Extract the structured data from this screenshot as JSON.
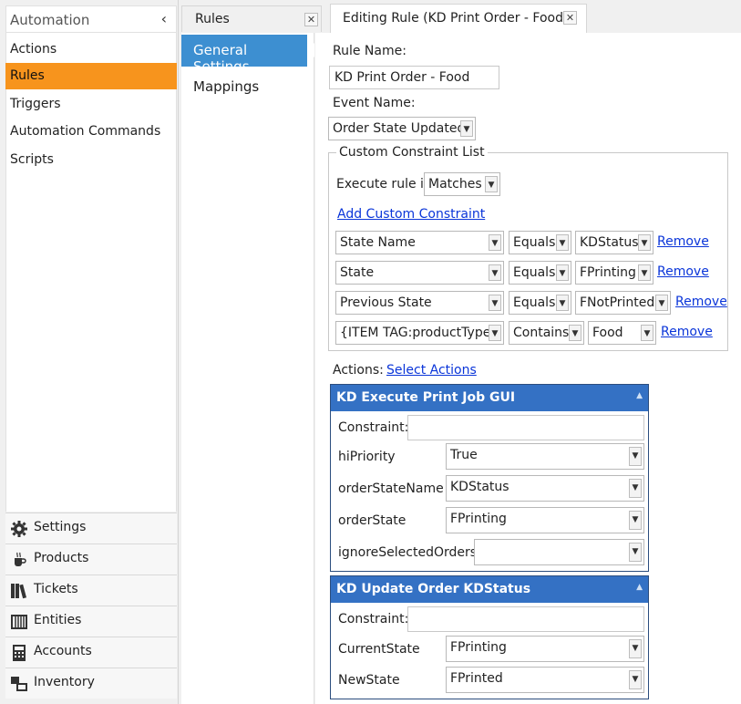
{
  "sidebar": {
    "header": "Automation",
    "items": [
      {
        "label": "Actions",
        "active": false
      },
      {
        "label": "Rules",
        "active": true
      },
      {
        "label": "Triggers",
        "active": false
      },
      {
        "label": "Automation Commands",
        "active": false
      },
      {
        "label": "Scripts",
        "active": false
      }
    ],
    "bottom_nav": [
      {
        "label": "Settings",
        "icon": "gear-icon"
      },
      {
        "label": "Products",
        "icon": "coffee-cup-icon"
      },
      {
        "label": "Tickets",
        "icon": "books-icon"
      },
      {
        "label": "Entities",
        "icon": "table-grid-icon"
      },
      {
        "label": "Accounts",
        "icon": "calculator-icon"
      },
      {
        "label": "Inventory",
        "icon": "stacked-boxes-icon"
      }
    ],
    "accent_color": "#f7941d"
  },
  "tabs": {
    "rules": {
      "label": "Rules",
      "close": "✕"
    },
    "editor": {
      "label": "Editing Rule (KD Print Order - Food)",
      "close": "✕"
    }
  },
  "subnav": {
    "items": [
      {
        "label": "General Settings",
        "active": true
      },
      {
        "label": "Mappings",
        "active": false
      }
    ],
    "active_color": "#3d8fd1"
  },
  "form": {
    "rule_name_label": "Rule Name:",
    "rule_name_value": "KD Print Order - Food",
    "event_name_label": "Event Name:",
    "event_name_value": "Order State Updated",
    "constraints": {
      "legend": "Custom Constraint List",
      "execute_label": "Execute rule if",
      "execute_value": "Matches",
      "add_link": "Add Custom Constraint",
      "remove_label": "Remove",
      "rows": [
        {
          "field": "State Name",
          "op": "Equals",
          "value": "KDStatus"
        },
        {
          "field": "State",
          "op": "Equals",
          "value": "FPrinting"
        },
        {
          "field": "Previous State",
          "op": "Equals",
          "value": "FNotPrinted"
        },
        {
          "field": "{ITEM TAG:productType}",
          "op": "Contains",
          "value": "Food"
        }
      ]
    },
    "actions_label": "Actions:",
    "select_actions_link": "Select Actions"
  },
  "actions": [
    {
      "title": "KD Execute Print Job GUI",
      "params": [
        {
          "label": "Constraint:",
          "value": "",
          "kind": "text"
        },
        {
          "label": "hiPriority",
          "value": "True",
          "kind": "select"
        },
        {
          "label": "orderStateName",
          "value": "KDStatus",
          "kind": "select"
        },
        {
          "label": "orderState",
          "value": "FPrinting",
          "kind": "select"
        },
        {
          "label": "ignoreSelectedOrders",
          "value": "",
          "kind": "select"
        }
      ]
    },
    {
      "title": "KD Update Order KDStatus",
      "params": [
        {
          "label": "Constraint:",
          "value": "",
          "kind": "text"
        },
        {
          "label": "CurrentState",
          "value": "FPrinting",
          "kind": "select"
        },
        {
          "label": "NewState",
          "value": "FPrinted",
          "kind": "select"
        }
      ]
    }
  ],
  "colors": {
    "panel_header": "#3471c4",
    "link": "#0a35d9"
  }
}
